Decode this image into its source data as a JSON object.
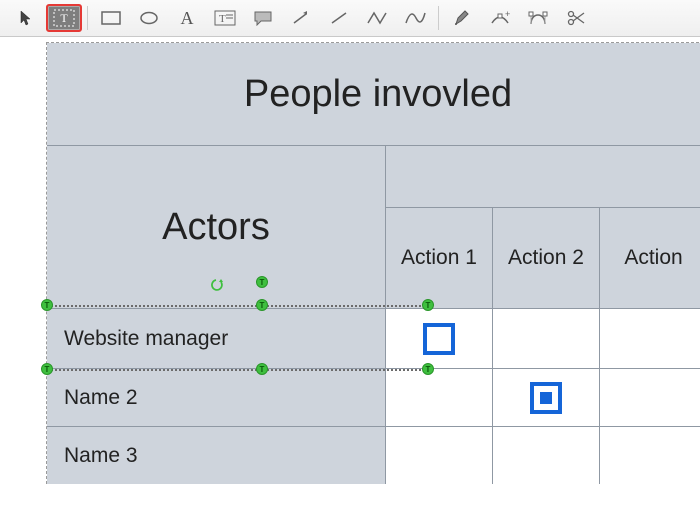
{
  "toolbar": {
    "tools": [
      {
        "name": "pointer-icon",
        "selected": false
      },
      {
        "name": "text-block-icon",
        "selected": true
      },
      {
        "name": "rectangle-icon",
        "selected": false
      },
      {
        "name": "ellipse-icon",
        "selected": false
      },
      {
        "name": "text-icon",
        "selected": false
      },
      {
        "name": "text-box-icon",
        "selected": false
      },
      {
        "name": "comment-icon",
        "selected": false
      },
      {
        "name": "arrow-icon",
        "selected": false
      },
      {
        "name": "line-icon",
        "selected": false
      },
      {
        "name": "polyline-icon",
        "selected": false
      },
      {
        "name": "curve-icon",
        "selected": false
      },
      {
        "name": "pen-icon",
        "selected": false
      },
      {
        "name": "add-node-icon",
        "selected": false
      },
      {
        "name": "bezier-icon",
        "selected": false
      },
      {
        "name": "scissors-icon",
        "selected": false
      }
    ]
  },
  "table": {
    "title": "People invovled",
    "group_label": "Actors",
    "action_columns": [
      "Action 1",
      "Action 2",
      "Action"
    ],
    "rows": [
      {
        "name": "Website manager",
        "cells": [
          "box-empty",
          "",
          ""
        ]
      },
      {
        "name": "Name 2",
        "cells": [
          "",
          "box-filled",
          ""
        ]
      },
      {
        "name": "Name 3",
        "cells": [
          "",
          "",
          ""
        ]
      }
    ]
  }
}
